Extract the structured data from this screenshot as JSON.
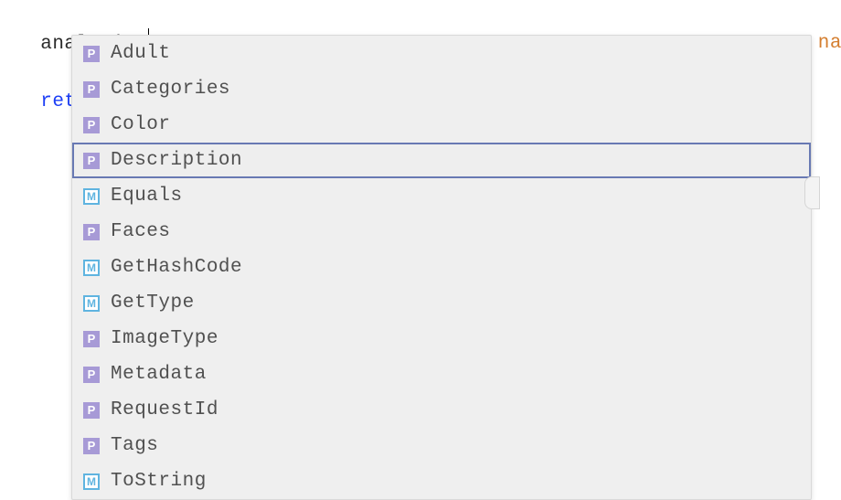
{
  "code": {
    "line1": "analysis.",
    "line2_keyword": "retur",
    "right_fragment": "na"
  },
  "autocomplete": {
    "selected_index": 3,
    "items": [
      {
        "kind": "property",
        "kind_letter": "P",
        "label": "Adult"
      },
      {
        "kind": "property",
        "kind_letter": "P",
        "label": "Categories"
      },
      {
        "kind": "property",
        "kind_letter": "P",
        "label": "Color"
      },
      {
        "kind": "property",
        "kind_letter": "P",
        "label": "Description"
      },
      {
        "kind": "method",
        "kind_letter": "M",
        "label": "Equals"
      },
      {
        "kind": "property",
        "kind_letter": "P",
        "label": "Faces"
      },
      {
        "kind": "method",
        "kind_letter": "M",
        "label": "GetHashCode"
      },
      {
        "kind": "method",
        "kind_letter": "M",
        "label": "GetType"
      },
      {
        "kind": "property",
        "kind_letter": "P",
        "label": "ImageType"
      },
      {
        "kind": "property",
        "kind_letter": "P",
        "label": "Metadata"
      },
      {
        "kind": "property",
        "kind_letter": "P",
        "label": "RequestId"
      },
      {
        "kind": "property",
        "kind_letter": "P",
        "label": "Tags"
      },
      {
        "kind": "method",
        "kind_letter": "M",
        "label": "ToString"
      }
    ]
  }
}
